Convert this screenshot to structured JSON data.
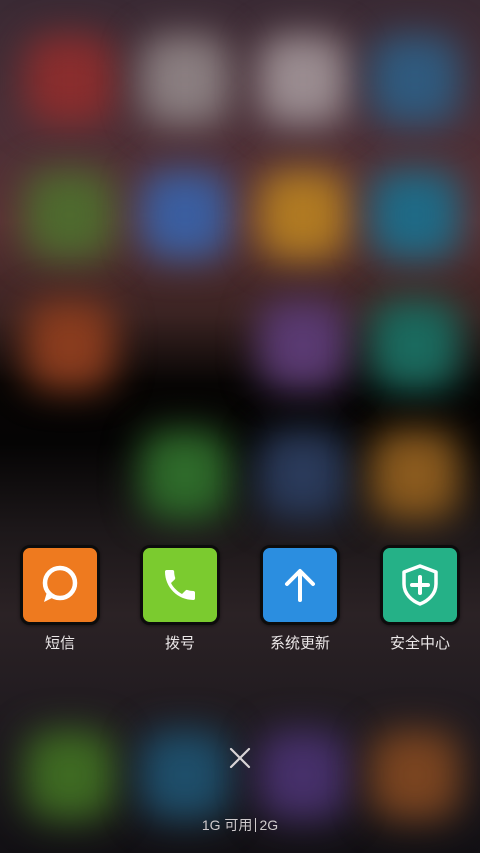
{
  "apps": [
    {
      "label": "短信",
      "icon": "message-bubble-icon",
      "color": "#ee7a1f"
    },
    {
      "label": "拨号",
      "icon": "phone-icon",
      "color": "#7bcb2f"
    },
    {
      "label": "系统更新",
      "icon": "arrow-up-icon",
      "color": "#2b8ee0"
    },
    {
      "label": "安全中心",
      "icon": "shield-plus-icon",
      "color": "#25b187"
    }
  ],
  "close_icon": "close-icon",
  "memory": {
    "available_label": "1G 可用",
    "total": "2G"
  }
}
